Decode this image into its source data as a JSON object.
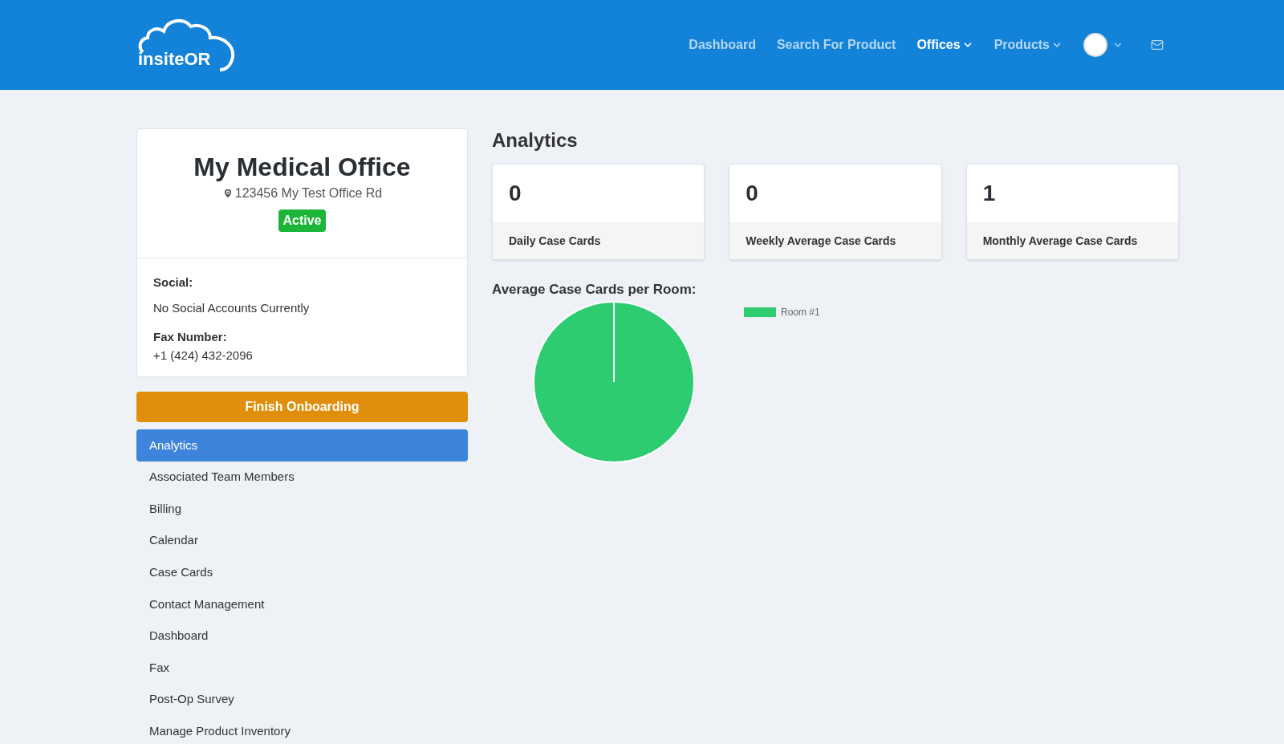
{
  "logo": {
    "text": "insiteOR"
  },
  "nav": [
    {
      "label": "Dashboard",
      "selected": false,
      "dropdown": false
    },
    {
      "label": "Search For Product",
      "selected": false,
      "dropdown": false
    },
    {
      "label": "Offices",
      "selected": true,
      "dropdown": true
    },
    {
      "label": "Products",
      "selected": false,
      "dropdown": true
    }
  ],
  "office": {
    "name": "My Medical Office",
    "address": "123456 My Test Office Rd",
    "status": "Active",
    "social_label": "Social:",
    "social_value": "No Social Accounts Currently",
    "fax_label": "Fax Number:",
    "fax_value": "+1 (424) 432-2096"
  },
  "onboarding_button": "Finish Onboarding",
  "sidebar": {
    "items": [
      {
        "label": "Analytics",
        "selected": true
      },
      {
        "label": "Associated Team Members",
        "selected": false
      },
      {
        "label": "Billing",
        "selected": false
      },
      {
        "label": "Calendar",
        "selected": false
      },
      {
        "label": "Case Cards",
        "selected": false
      },
      {
        "label": "Contact Management",
        "selected": false
      },
      {
        "label": "Dashboard",
        "selected": false
      },
      {
        "label": "Fax",
        "selected": false
      },
      {
        "label": "Post-Op Survey",
        "selected": false
      },
      {
        "label": "Manage Product Inventory",
        "selected": false
      }
    ]
  },
  "analytics": {
    "title": "Analytics",
    "stats": [
      {
        "value": "0",
        "label": "Daily Case Cards"
      },
      {
        "value": "0",
        "label": "Weekly Average Case Cards"
      },
      {
        "value": "1",
        "label": "Monthly Average Case Cards"
      }
    ],
    "chart_title": "Average Case Cards per Room:",
    "legend": [
      {
        "label": "Room #1",
        "color": "#2ecc71"
      }
    ]
  }
}
